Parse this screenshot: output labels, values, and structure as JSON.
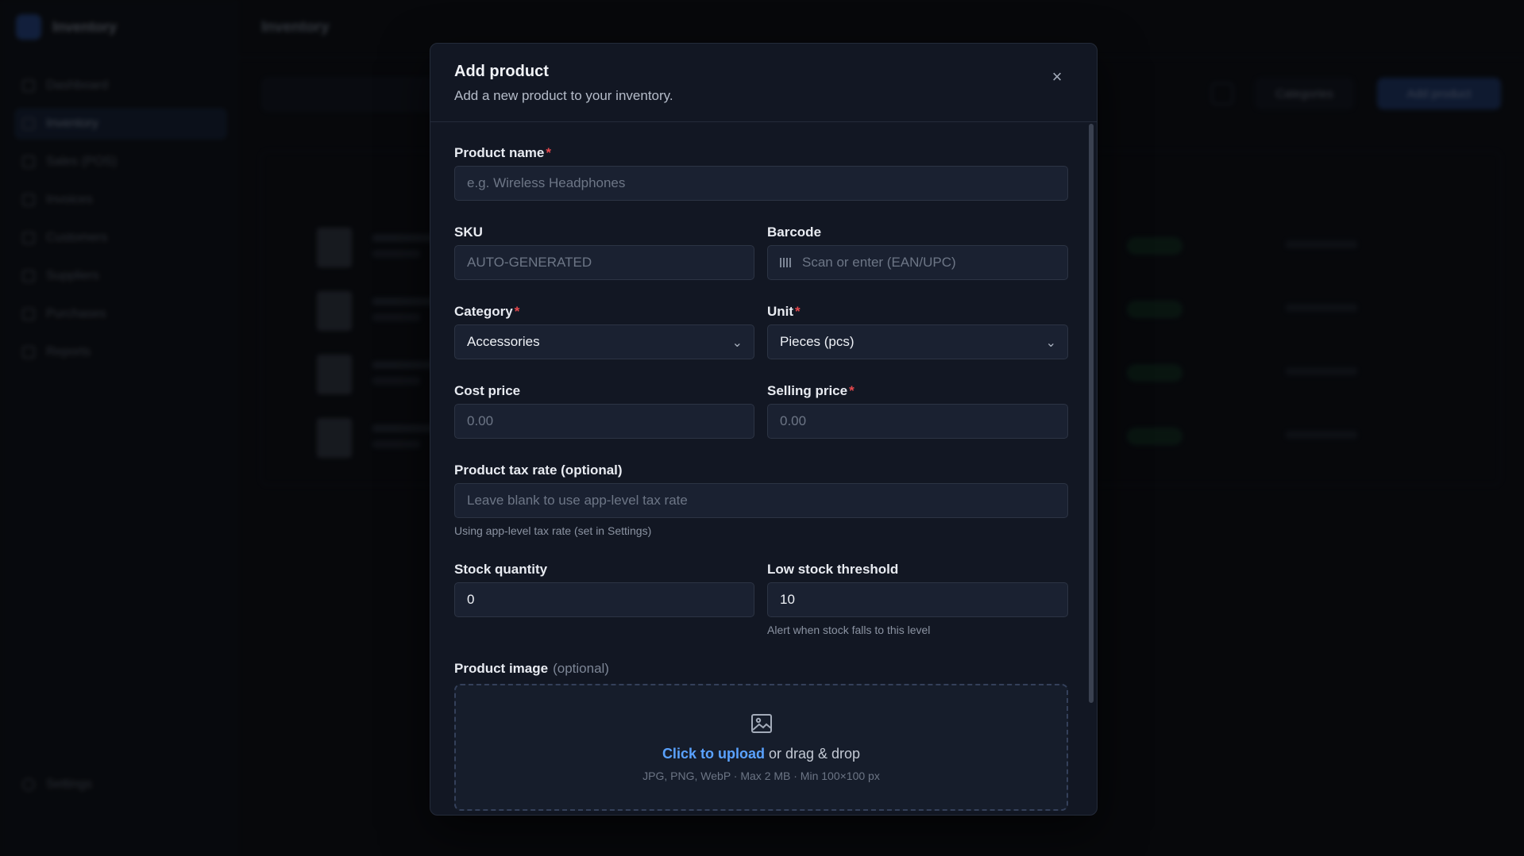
{
  "background": {
    "app_name": "Inventory",
    "page_title": "Inventory",
    "nav": [
      "Dashboard",
      "Inventory",
      "Sales (POS)",
      "Invoices",
      "Customers",
      "Suppliers",
      "Purchases",
      "Reports"
    ],
    "settings_label": "Settings",
    "categories_button": "Categories",
    "add_product_button": "Add product"
  },
  "modal": {
    "title": "Add product",
    "subtitle": "Add a new product to your inventory.",
    "close_icon": "×",
    "product_name": {
      "label": "Product name",
      "placeholder": "e.g. Wireless Headphones"
    },
    "sku": {
      "label": "SKU",
      "placeholder": "AUTO-GENERATED"
    },
    "barcode": {
      "label": "Barcode",
      "placeholder": "Scan or enter (EAN/UPC)"
    },
    "category": {
      "label": "Category",
      "value": "Accessories"
    },
    "unit": {
      "label": "Unit",
      "value": "Pieces (pcs)"
    },
    "cost_price": {
      "label": "Cost price",
      "placeholder": "0.00"
    },
    "selling_price": {
      "label": "Selling price",
      "placeholder": "0.00"
    },
    "tax_rate": {
      "label": "Product tax rate (optional)",
      "placeholder": "Leave blank to use app-level tax rate",
      "helper": "Using app-level tax rate (set in Settings)"
    },
    "stock_quantity": {
      "label": "Stock quantity",
      "value": "0"
    },
    "low_stock": {
      "label": "Low stock threshold",
      "value": "10",
      "helper": "Alert when stock falls to this level"
    },
    "image": {
      "label": "Product image",
      "optional": "(optional)",
      "upload_link": "Click to upload",
      "upload_rest": "or drag & drop",
      "hint": "JPG, PNG, WebP · Max 2 MB · Min 100×100 px"
    }
  },
  "colors": {
    "accent": "#5aa2ff",
    "required": "#e5484d",
    "modal_bg": "#121723"
  }
}
